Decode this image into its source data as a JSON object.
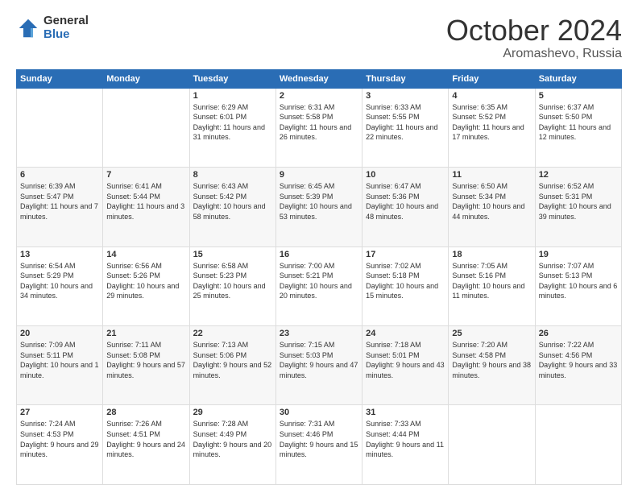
{
  "header": {
    "logo_general": "General",
    "logo_blue": "Blue",
    "month_title": "October 2024",
    "location": "Aromashevo, Russia"
  },
  "days_of_week": [
    "Sunday",
    "Monday",
    "Tuesday",
    "Wednesday",
    "Thursday",
    "Friday",
    "Saturday"
  ],
  "weeks": [
    [
      {
        "day": "",
        "info": ""
      },
      {
        "day": "",
        "info": ""
      },
      {
        "day": "1",
        "info": "Sunrise: 6:29 AM\nSunset: 6:01 PM\nDaylight: 11 hours and 31 minutes."
      },
      {
        "day": "2",
        "info": "Sunrise: 6:31 AM\nSunset: 5:58 PM\nDaylight: 11 hours and 26 minutes."
      },
      {
        "day": "3",
        "info": "Sunrise: 6:33 AM\nSunset: 5:55 PM\nDaylight: 11 hours and 22 minutes."
      },
      {
        "day": "4",
        "info": "Sunrise: 6:35 AM\nSunset: 5:52 PM\nDaylight: 11 hours and 17 minutes."
      },
      {
        "day": "5",
        "info": "Sunrise: 6:37 AM\nSunset: 5:50 PM\nDaylight: 11 hours and 12 minutes."
      }
    ],
    [
      {
        "day": "6",
        "info": "Sunrise: 6:39 AM\nSunset: 5:47 PM\nDaylight: 11 hours and 7 minutes."
      },
      {
        "day": "7",
        "info": "Sunrise: 6:41 AM\nSunset: 5:44 PM\nDaylight: 11 hours and 3 minutes."
      },
      {
        "day": "8",
        "info": "Sunrise: 6:43 AM\nSunset: 5:42 PM\nDaylight: 10 hours and 58 minutes."
      },
      {
        "day": "9",
        "info": "Sunrise: 6:45 AM\nSunset: 5:39 PM\nDaylight: 10 hours and 53 minutes."
      },
      {
        "day": "10",
        "info": "Sunrise: 6:47 AM\nSunset: 5:36 PM\nDaylight: 10 hours and 48 minutes."
      },
      {
        "day": "11",
        "info": "Sunrise: 6:50 AM\nSunset: 5:34 PM\nDaylight: 10 hours and 44 minutes."
      },
      {
        "day": "12",
        "info": "Sunrise: 6:52 AM\nSunset: 5:31 PM\nDaylight: 10 hours and 39 minutes."
      }
    ],
    [
      {
        "day": "13",
        "info": "Sunrise: 6:54 AM\nSunset: 5:29 PM\nDaylight: 10 hours and 34 minutes."
      },
      {
        "day": "14",
        "info": "Sunrise: 6:56 AM\nSunset: 5:26 PM\nDaylight: 10 hours and 29 minutes."
      },
      {
        "day": "15",
        "info": "Sunrise: 6:58 AM\nSunset: 5:23 PM\nDaylight: 10 hours and 25 minutes."
      },
      {
        "day": "16",
        "info": "Sunrise: 7:00 AM\nSunset: 5:21 PM\nDaylight: 10 hours and 20 minutes."
      },
      {
        "day": "17",
        "info": "Sunrise: 7:02 AM\nSunset: 5:18 PM\nDaylight: 10 hours and 15 minutes."
      },
      {
        "day": "18",
        "info": "Sunrise: 7:05 AM\nSunset: 5:16 PM\nDaylight: 10 hours and 11 minutes."
      },
      {
        "day": "19",
        "info": "Sunrise: 7:07 AM\nSunset: 5:13 PM\nDaylight: 10 hours and 6 minutes."
      }
    ],
    [
      {
        "day": "20",
        "info": "Sunrise: 7:09 AM\nSunset: 5:11 PM\nDaylight: 10 hours and 1 minute."
      },
      {
        "day": "21",
        "info": "Sunrise: 7:11 AM\nSunset: 5:08 PM\nDaylight: 9 hours and 57 minutes."
      },
      {
        "day": "22",
        "info": "Sunrise: 7:13 AM\nSunset: 5:06 PM\nDaylight: 9 hours and 52 minutes."
      },
      {
        "day": "23",
        "info": "Sunrise: 7:15 AM\nSunset: 5:03 PM\nDaylight: 9 hours and 47 minutes."
      },
      {
        "day": "24",
        "info": "Sunrise: 7:18 AM\nSunset: 5:01 PM\nDaylight: 9 hours and 43 minutes."
      },
      {
        "day": "25",
        "info": "Sunrise: 7:20 AM\nSunset: 4:58 PM\nDaylight: 9 hours and 38 minutes."
      },
      {
        "day": "26",
        "info": "Sunrise: 7:22 AM\nSunset: 4:56 PM\nDaylight: 9 hours and 33 minutes."
      }
    ],
    [
      {
        "day": "27",
        "info": "Sunrise: 7:24 AM\nSunset: 4:53 PM\nDaylight: 9 hours and 29 minutes."
      },
      {
        "day": "28",
        "info": "Sunrise: 7:26 AM\nSunset: 4:51 PM\nDaylight: 9 hours and 24 minutes."
      },
      {
        "day": "29",
        "info": "Sunrise: 7:28 AM\nSunset: 4:49 PM\nDaylight: 9 hours and 20 minutes."
      },
      {
        "day": "30",
        "info": "Sunrise: 7:31 AM\nSunset: 4:46 PM\nDaylight: 9 hours and 15 minutes."
      },
      {
        "day": "31",
        "info": "Sunrise: 7:33 AM\nSunset: 4:44 PM\nDaylight: 9 hours and 11 minutes."
      },
      {
        "day": "",
        "info": ""
      },
      {
        "day": "",
        "info": ""
      }
    ]
  ]
}
